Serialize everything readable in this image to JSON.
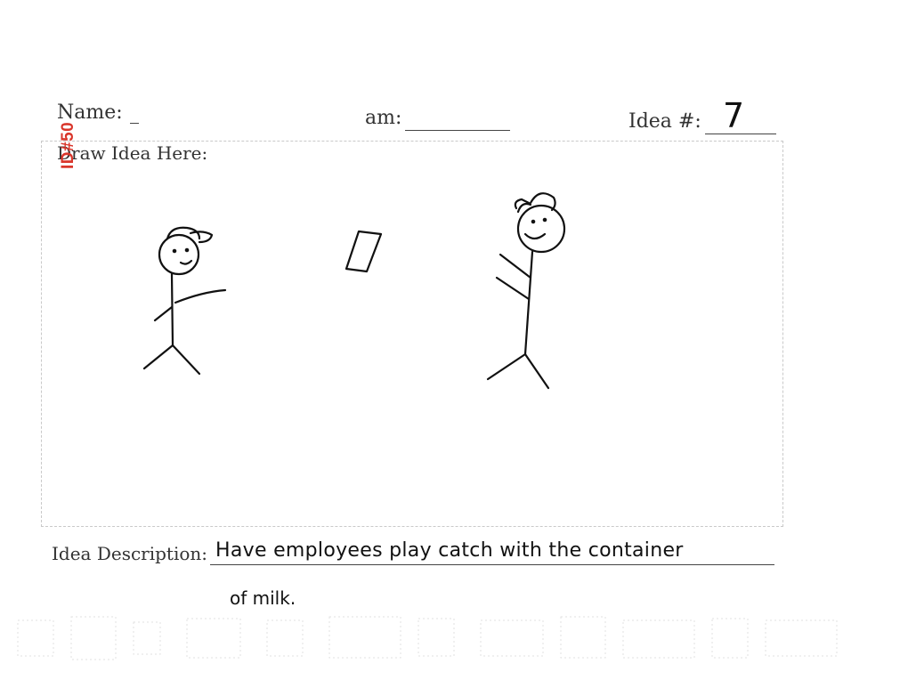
{
  "form": {
    "name_label": "Name:",
    "team_label_fragment": "am:",
    "idea_number_label": "Idea #:",
    "idea_number_value": "7",
    "draw_label": "Draw Idea Here:",
    "description_label": "Idea Description:",
    "description_line1": "Have employees play catch with the container",
    "description_line2": "of milk."
  },
  "stamp": {
    "id_text": "ID#50",
    "color": "#d9362b"
  },
  "colors": {
    "ink": "#111111",
    "print": "#333333"
  }
}
